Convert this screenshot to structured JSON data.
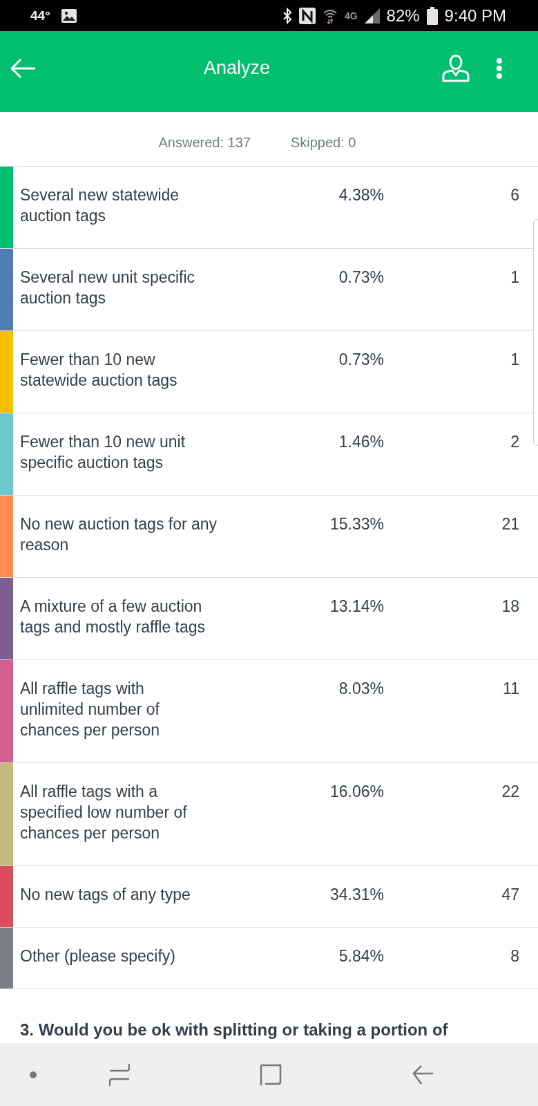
{
  "status_bar": {
    "temperature": "44°",
    "network": "4G",
    "battery": "82%",
    "time": "9:40 PM"
  },
  "app_bar": {
    "title": "Analyze"
  },
  "summary": {
    "answered": "Answered: 137",
    "skipped": "Skipped: 0"
  },
  "choices": [
    {
      "label": "Several new statewide\nauction tags",
      "percent": "4.38%",
      "count": "6",
      "color": "#00bf6f"
    },
    {
      "label": "Several new unit specific\nauction tags",
      "percent": "0.73%",
      "count": "1",
      "color": "#507cb6"
    },
    {
      "label": "Fewer than 10 new\nstatewide auction tags",
      "percent": "0.73%",
      "count": "1",
      "color": "#f9be00"
    },
    {
      "label": "Fewer than 10 new unit\nspecific auction tags",
      "percent": "1.46%",
      "count": "2",
      "color": "#6bc8cd"
    },
    {
      "label": "No new auction tags for any\nreason",
      "percent": "15.33%",
      "count": "21",
      "color": "#ff8b4f"
    },
    {
      "label": "A mixture of a few auction\ntags and mostly raffle tags",
      "percent": "13.14%",
      "count": "18",
      "color": "#7d5e90"
    },
    {
      "label": "All raffle tags with\nunlimited number of\nchances per person",
      "percent": "8.03%",
      "count": "11",
      "color": "#d25f90"
    },
    {
      "label": "All raffle tags with a\nspecified low number of\nchances per person",
      "percent": "16.06%",
      "count": "22",
      "color": "#c4b97c"
    },
    {
      "label": "No new tags of any type",
      "percent": "34.31%",
      "count": "47",
      "color": "#db4d5c"
    },
    {
      "label": "Other (please specify)",
      "percent": "5.84%",
      "count": "8",
      "color": "#768086"
    }
  ],
  "next_question": "3. Would you be ok with splitting or taking a portion of"
}
